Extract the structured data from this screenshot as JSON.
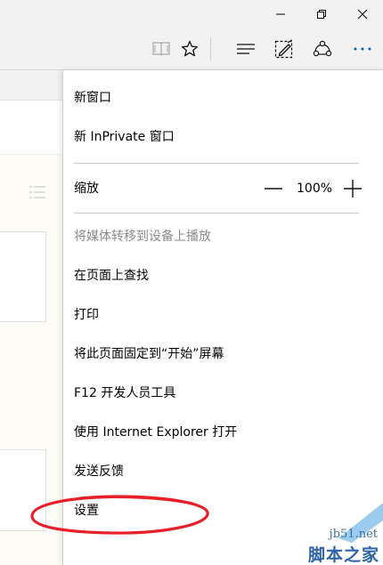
{
  "window": {
    "minimize_icon": "minimize-icon",
    "restore_icon": "restore-icon",
    "close_icon": "close-icon"
  },
  "toolbar": {
    "reading_view_icon": "book-icon",
    "favorite_icon": "star-icon",
    "hub_icon": "hub-lines-icon",
    "web_note_icon": "pen-note-icon",
    "share_icon": "share-icon",
    "more_icon": "more-dots-icon"
  },
  "menu": {
    "new_window": "新窗口",
    "new_inprivate": "新 InPrivate 窗口",
    "zoom_label": "缩放",
    "zoom_value": "100%",
    "cast_media": "将媒体转移到设备上播放",
    "find_on_page": "在页面上查找",
    "print": "打印",
    "pin_to_start": "将此页面固定到“开始”屏幕",
    "f12_tools": "F12 开发人员工具",
    "open_with_ie": "使用 Internet Explorer 打开",
    "send_feedback": "发送反馈",
    "settings": "设置"
  },
  "colors": {
    "accent": "#0063b1",
    "annotation": "#e8202a"
  },
  "watermark": {
    "url": "jb51.net",
    "text": "脚本之家"
  }
}
